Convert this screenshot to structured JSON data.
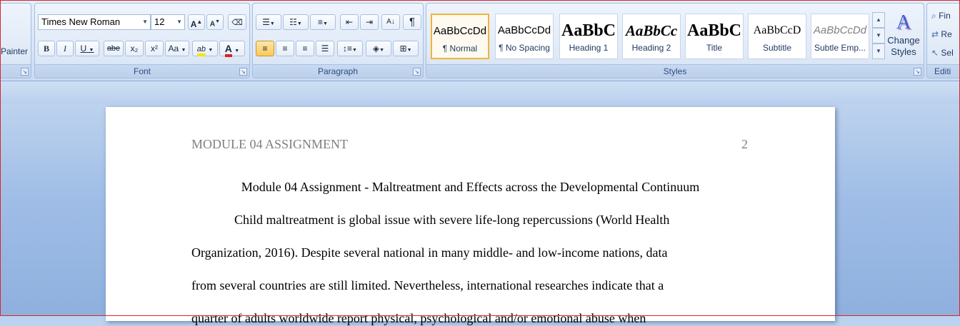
{
  "clipboard": {
    "format_painter_label": "Painter"
  },
  "font": {
    "name": "Times New Roman",
    "size": "12",
    "group_label": "Font",
    "grow_label": "A",
    "shrink_label": "A",
    "bold_label": "B",
    "italic_label": "I",
    "underline_label": "U",
    "strike_label": "abe",
    "subscript_label": "x₂",
    "superscript_label": "x²",
    "change_case_label": "Aa",
    "highlight_label": "ab",
    "font_color_label": "A",
    "highlight_color": "#f7e400",
    "font_color": "#e02020"
  },
  "paragraph": {
    "group_label": "Paragraph",
    "pilcrow": "¶",
    "sort_label": "A↓"
  },
  "styles": {
    "group_label": "Styles",
    "items": [
      {
        "sample": "AaBbCcDd",
        "name": "¶ Normal"
      },
      {
        "sample": "AaBbCcDd",
        "name": "¶ No Spacing"
      },
      {
        "sample": "AaBbC",
        "name": "Heading 1"
      },
      {
        "sample": "AaBbCc",
        "name": "Heading 2"
      },
      {
        "sample": "AaBbC",
        "name": "Title"
      },
      {
        "sample": "AaBbCcD",
        "name": "Subtitle"
      },
      {
        "sample": "AaBbCcDd",
        "name": "Subtle Emp..."
      }
    ],
    "change_styles_line1": "Change",
    "change_styles_line2": "Styles"
  },
  "editing": {
    "find_label": "Fin",
    "replace_label": "Re",
    "select_label": "Sel",
    "group_label": "Editi"
  },
  "document": {
    "header_text": "MODULE 04 ASSIGNMENT",
    "page_number": "2",
    "title": "Module 04 Assignment - Maltreatment and Effects across the Developmental Continuum",
    "lines": [
      "Child maltreatment is global issue with severe life-long repercussions (World Health",
      "Organization, 2016). Despite several national in many middle- and low-income nations, data",
      "from several countries are still limited. Nevertheless, international researches indicate that a",
      "quarter of adults worldwide report physical, psychological and/or emotional abuse when"
    ]
  }
}
